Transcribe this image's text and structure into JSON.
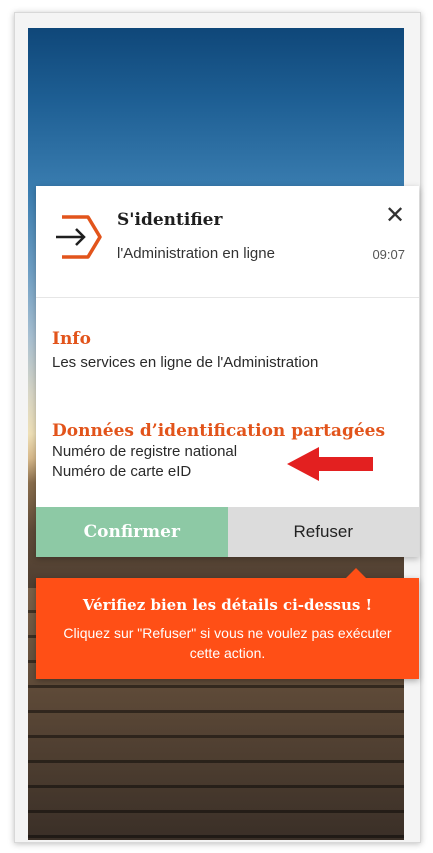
{
  "notification": {
    "title": "S'identifier",
    "subtitle": "l'Administration en ligne",
    "time": "09:07",
    "close_icon": "close-icon"
  },
  "info": {
    "heading": "Info",
    "text": "Les services en ligne de l'Administration"
  },
  "shared_data": {
    "heading": "Données d’identification partagées",
    "items": [
      "Numéro de registre national",
      "Numéro de carte eID"
    ]
  },
  "actions": {
    "confirm_label": "Confirmer",
    "refuse_label": "Refuser"
  },
  "warning": {
    "title": "Vérifiez bien les détails ci-dessus !",
    "text": "Cliquez sur \"Refuser\" si vous ne voulez pas exécuter cette action."
  },
  "colors": {
    "accent": "#e2541b",
    "confirm": "#8dc9a5",
    "warning": "#ff4f16",
    "arrow": "#e32020"
  }
}
